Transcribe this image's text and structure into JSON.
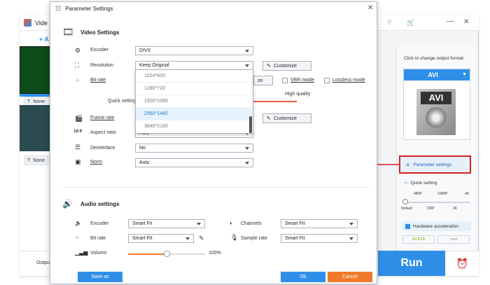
{
  "background_app": {
    "title": "Vide",
    "add_label": "+ A",
    "files": [
      {
        "label": "None"
      },
      {
        "label": "None"
      }
    ],
    "output_label": "Outpu",
    "run_label": "Run",
    "right_panel": {
      "change_format_text": "Click to change output format:",
      "format_name": "AVI",
      "format_badge": "AVI",
      "param_settings_label": "Parameter settings",
      "quick_setting_label": "Quick setting",
      "quick_setting_top_ticks": [
        "480P",
        "1080P",
        "4K"
      ],
      "quick_setting_bottom_ticks": [
        "Default",
        "720P",
        "2K"
      ],
      "hw_accel_label": "Hardware acceleration",
      "nvidia_label": "NVIDIA",
      "intel_label": "Intel"
    }
  },
  "dialog": {
    "title": "Parameter Settings",
    "video": {
      "section_title": "Video Settings",
      "encoder": {
        "label": "Encoder",
        "value": "DIVX"
      },
      "resolution": {
        "label": "Resolution",
        "value": "Keep Original"
      },
      "customize_label": "Customize",
      "bitrate": {
        "label": "Bit rate",
        "quick_setting": "Quick setting",
        "high_quality": "High quality",
        "vbr_label": "VBR mode",
        "lossless_label": "Lossless mode",
        "partial_button": "ze"
      },
      "frame_rate": {
        "label": "Frame rate"
      },
      "aspect_ratio": {
        "label": "Aspect ratio",
        "value": "Auto"
      },
      "deinterlace": {
        "label": "Deinterlace",
        "value": "No"
      },
      "norm": {
        "label": "Norm",
        "value": "Auto"
      },
      "resolution_options": [
        "1024*600",
        "1280*720",
        "1920*1080",
        "2560*1440",
        "3840*2160"
      ],
      "selected_option": "2560*1440"
    },
    "audio": {
      "section_title": "Audio settings",
      "encoder": {
        "label": "Encoder",
        "value": "Smart Fit"
      },
      "channels": {
        "label": "Channels",
        "value": "Smart Fit"
      },
      "bitrate": {
        "label": "Bit rate",
        "value": "Smart Fit"
      },
      "sample_rate": {
        "label": "Sample rate",
        "value": "Smart Fit"
      },
      "volume": {
        "label": "Volume",
        "value": "100%",
        "level": 0.5
      }
    },
    "footer": {
      "save_as": "Save as",
      "ok": "Ok",
      "cancel": "Cancel"
    }
  },
  "colors": {
    "accent": "#2f8fe8",
    "cancel": "#f07a2a",
    "highlight_border": "#d62020",
    "arrow": "#d62020"
  }
}
